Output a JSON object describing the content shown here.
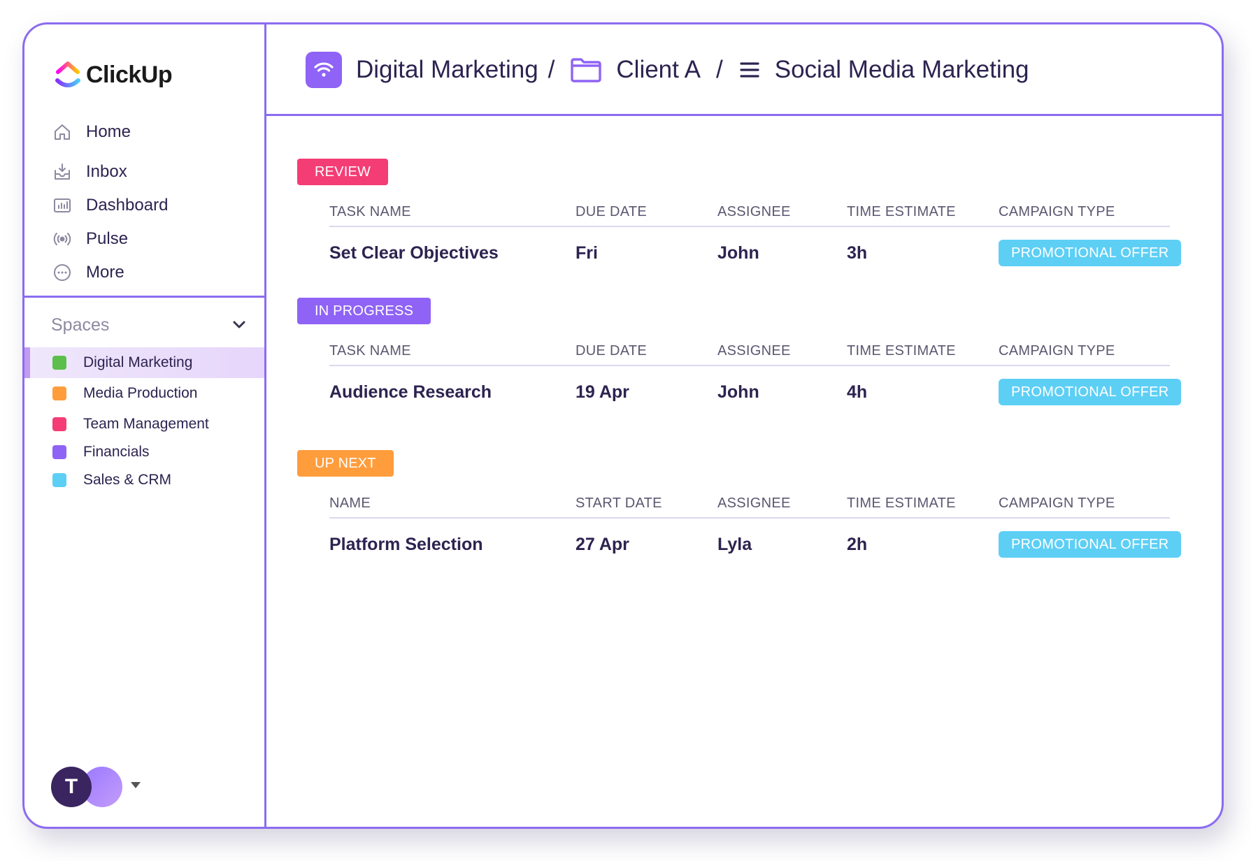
{
  "app": {
    "logo_text": "ClickUp"
  },
  "nav": {
    "items": [
      {
        "label": "Home",
        "icon": "home-icon"
      },
      {
        "label": "Inbox",
        "icon": "inbox-icon"
      },
      {
        "label": "Dashboard",
        "icon": "dashboard-icon"
      },
      {
        "label": "Pulse",
        "icon": "pulse-icon"
      },
      {
        "label": "More",
        "icon": "more-icon"
      }
    ]
  },
  "spaces": {
    "title": "Spaces",
    "items": [
      {
        "label": "Digital Marketing",
        "color": "#5cbf4c",
        "active": true
      },
      {
        "label": "Media Production",
        "color": "#ff9d3d"
      },
      {
        "label": "Team Management",
        "color": "#f43c75"
      },
      {
        "label": "Financials",
        "color": "#8f63f5"
      },
      {
        "label": "Sales & CRM",
        "color": "#5dcff5"
      }
    ]
  },
  "user": {
    "avatar_initial": "T"
  },
  "breadcrumb": {
    "space": "Digital Marketing",
    "folder": "Client A",
    "list": "Social Media Marketing",
    "separator": "/"
  },
  "groups": [
    {
      "status": "REVIEW",
      "color": "#f43c75",
      "columns": [
        "TASK NAME",
        "DUE DATE",
        "ASSIGNEE",
        "TIME ESTIMATE",
        "CAMPAIGN TYPE"
      ],
      "row": {
        "name": "Set Clear Objectives",
        "date": "Fri",
        "assignee": "John",
        "estimate": "3h",
        "campaign": "PROMOTIONAL OFFER"
      }
    },
    {
      "status": "IN PROGRESS",
      "color": "#8f63f5",
      "columns": [
        "TASK NAME",
        "DUE DATE",
        "ASSIGNEE",
        "TIME ESTIMATE",
        "CAMPAIGN TYPE"
      ],
      "row": {
        "name": "Audience Research",
        "date": "19 Apr",
        "assignee": "John",
        "estimate": "4h",
        "campaign": "PROMOTIONAL OFFER"
      }
    },
    {
      "status": "UP NEXT",
      "color": "#ff9d3d",
      "columns": [
        "NAME",
        "START DATE",
        "ASSIGNEE",
        "TIME ESTIMATE",
        "CAMPAIGN TYPE"
      ],
      "row": {
        "name": "Platform Selection",
        "date": "27 Apr",
        "assignee": "Lyla",
        "estimate": "2h",
        "campaign": "PROMOTIONAL OFFER"
      }
    }
  ]
}
